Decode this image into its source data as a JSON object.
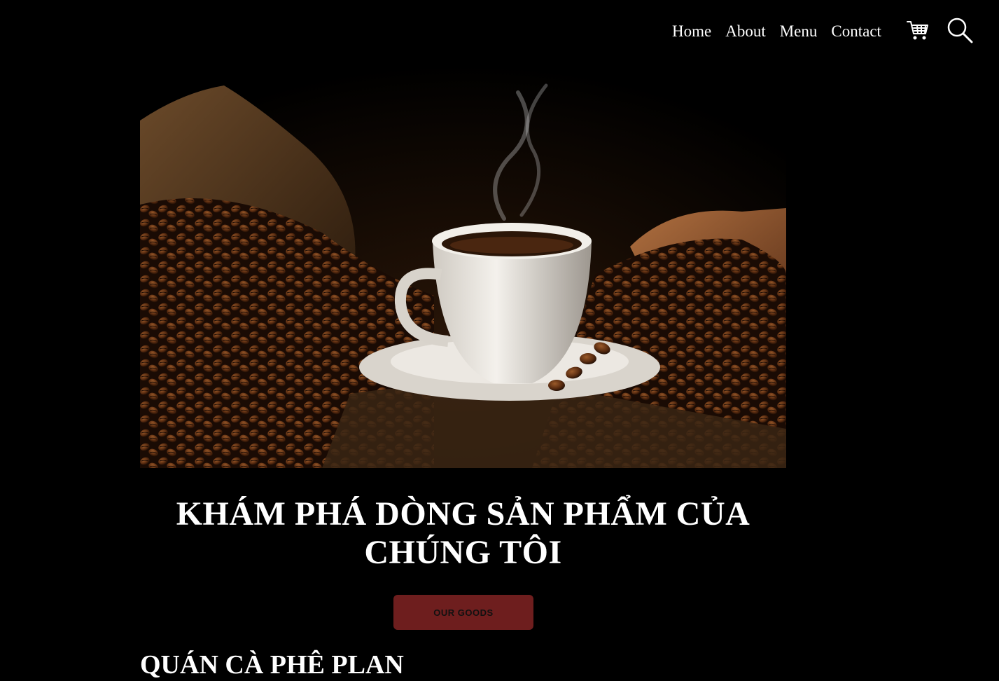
{
  "nav": {
    "items": [
      {
        "label": "Home"
      },
      {
        "label": "About"
      },
      {
        "label": "Menu"
      },
      {
        "label": "Contact"
      }
    ],
    "cart_icon": "cart-icon",
    "search_icon": "search-icon"
  },
  "hero": {
    "image": "coffee-cup-and-beans-photo",
    "headline": "KHÁM PHÁ DÒNG SẢN PHẨM CỦA CHÚNG TÔI",
    "button_label": "OUR GOODS",
    "button_color": "#6e1e1e"
  },
  "section": {
    "title": "QUÁN CÀ PHÊ PLAN"
  }
}
